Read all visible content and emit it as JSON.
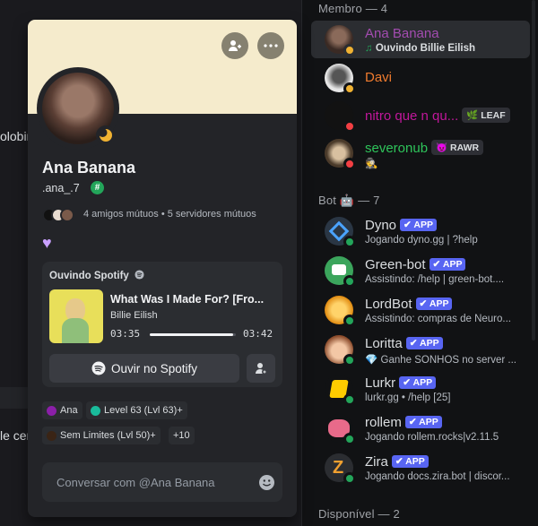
{
  "chat": {
    "fragment1": "olobin",
    "fragment2": "le cen"
  },
  "popout": {
    "display_name": "Ana Banana",
    "username": ".ana_.7",
    "hash_badge": "#",
    "mutual_text": "4 amigos mútuos • 5 servidores mútuos",
    "heart": "♥",
    "buttons": {
      "add_friend_icon": "add-friend-icon",
      "more_icon": "more-icon"
    },
    "activity": {
      "header": "Ouvindo Spotify",
      "song": "What Was I Made For? [Fro...",
      "artist": "Billie Eilish",
      "time_elapsed": "03:35",
      "time_total": "03:42",
      "progress_fraction": 0.97,
      "listen_button": "Ouvir no Spotify"
    },
    "roles": [
      {
        "label": "Ana",
        "color": "#8b1fa8"
      },
      {
        "label": "Level 63 (Lvl 63)+",
        "color": "#1abc9c"
      },
      {
        "label": "Sem Limites (Lvl 50)+",
        "color": "#3a2415"
      },
      {
        "label": "+10",
        "color": ""
      }
    ],
    "message_placeholder": "Conversar com @Ana Banana"
  },
  "members": {
    "header_members": "Membro — 4",
    "header_bots": "Bot 🤖 — 7",
    "header_available": "Disponível — 2",
    "users": [
      {
        "name": "Ana Banana",
        "color": "#a34cb0",
        "sub_prefix": "♫",
        "sub": "Ouvindo Billie Eilish",
        "status": "idle",
        "badge": "",
        "avatar": "#3a2a24"
      },
      {
        "name": "Davi",
        "color": "#f07b2e",
        "sub_prefix": "",
        "sub": "",
        "status": "idle",
        "badge": "",
        "avatar": "#d8d8d8"
      },
      {
        "name": "nitro que n qu...",
        "color": "#c1179b",
        "sub_prefix": "",
        "sub": "",
        "status": "dnd",
        "badge": "🌿 LEAF",
        "avatar": "#121212"
      },
      {
        "name": "severonub",
        "color": "#2ec45a",
        "sub_prefix": "",
        "sub": "🕵️",
        "status": "dnd",
        "badge": "😈 RAWR",
        "avatar": "#4a3a2a"
      }
    ],
    "bots": [
      {
        "name": "Dyno",
        "sub": "Jogando dyno.gg | ?help",
        "app": "✔ APP",
        "avatar": "#2a3644"
      },
      {
        "name": "Green-bot",
        "sub": "Assistindo: /help | green-bot....",
        "app": "✔ APP",
        "avatar": "#3ba55c"
      },
      {
        "name": "LordBot",
        "sub": "Assistindo: compras de Neuro...",
        "app": "✔ APP",
        "avatar": "#f0a020"
      },
      {
        "name": "Loritta",
        "sub": "💎 Ganhe SONHOS no server ...",
        "app": "✔ APP",
        "avatar": "#e07b5a"
      },
      {
        "name": "Lurkr",
        "sub": "lurkr.gg • /help [25]",
        "app": "✔ APP",
        "avatar": "#ffcc00"
      },
      {
        "name": "rollem",
        "sub": "Jogando rollem.rocks|v2.11.5",
        "app": "✔ APP",
        "avatar": "#e86a8a"
      },
      {
        "name": "Zira",
        "sub": "Jogando docs.zira.bot | discor...",
        "app": "✔ APP",
        "avatar": "#2b2d31"
      }
    ]
  }
}
